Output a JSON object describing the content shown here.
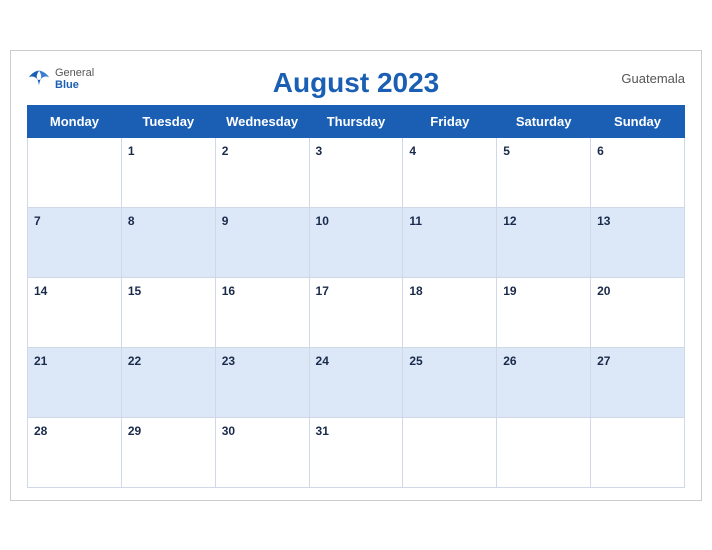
{
  "header": {
    "title": "August 2023",
    "country": "Guatemala",
    "logo": {
      "general": "General",
      "blue": "Blue"
    }
  },
  "weekdays": [
    "Monday",
    "Tuesday",
    "Wednesday",
    "Thursday",
    "Friday",
    "Saturday",
    "Sunday"
  ],
  "weeks": [
    [
      null,
      1,
      2,
      3,
      4,
      5,
      6
    ],
    [
      7,
      8,
      9,
      10,
      11,
      12,
      13
    ],
    [
      14,
      15,
      16,
      17,
      18,
      19,
      20
    ],
    [
      21,
      22,
      23,
      24,
      25,
      26,
      27
    ],
    [
      28,
      29,
      30,
      31,
      null,
      null,
      null
    ]
  ]
}
